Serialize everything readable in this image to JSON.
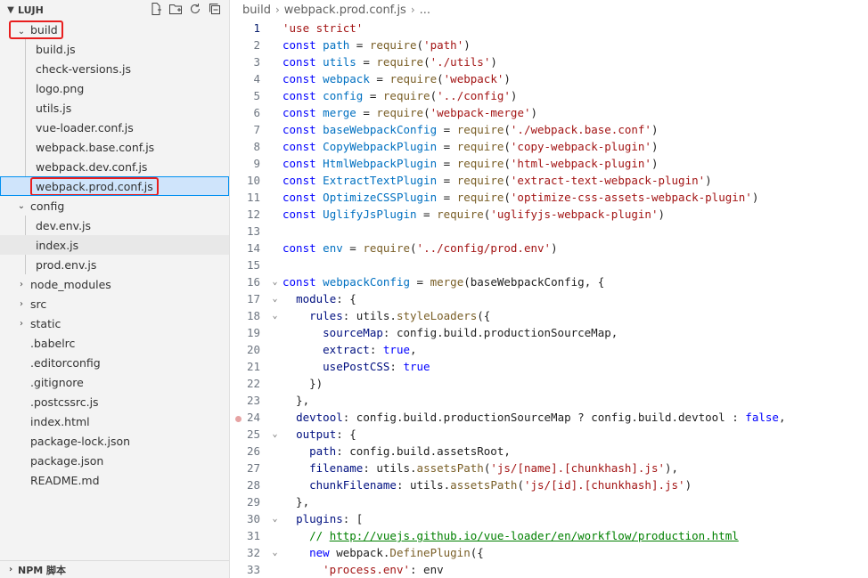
{
  "sidebar": {
    "title": "LUJH",
    "actions": [
      "new-file-icon",
      "new-folder-icon",
      "refresh-icon",
      "collapse-all-icon"
    ],
    "build_folder": "build",
    "build_files": [
      "build.js",
      "check-versions.js",
      "logo.png",
      "utils.js",
      "vue-loader.conf.js",
      "webpack.base.conf.js",
      "webpack.dev.conf.js",
      "webpack.prod.conf.js"
    ],
    "config_folder": "config",
    "config_files": [
      "dev.env.js",
      "index.js",
      "prod.env.js"
    ],
    "folders": [
      "node_modules",
      "src",
      "static"
    ],
    "root_files": [
      ".babelrc",
      ".editorconfig",
      ".gitignore",
      ".postcssrc.js",
      "index.html",
      "package-lock.json",
      "package.json",
      "README.md"
    ],
    "footer": "NPM 脚本"
  },
  "breadcrumb": {
    "folder": "build",
    "file": "webpack.prod.conf.js",
    "more": "..."
  },
  "code_lines": [
    {
      "n": "1",
      "t": "'use strict'"
    },
    {
      "n": "2",
      "t": "const path = require('path')"
    },
    {
      "n": "3",
      "t": "const utils = require('./utils')"
    },
    {
      "n": "4",
      "t": "const webpack = require('webpack')"
    },
    {
      "n": "5",
      "t": "const config = require('../config')"
    },
    {
      "n": "6",
      "t": "const merge = require('webpack-merge')"
    },
    {
      "n": "7",
      "t": "const baseWebpackConfig = require('./webpack.base.conf')"
    },
    {
      "n": "8",
      "t": "const CopyWebpackPlugin = require('copy-webpack-plugin')"
    },
    {
      "n": "9",
      "t": "const HtmlWebpackPlugin = require('html-webpack-plugin')"
    },
    {
      "n": "10",
      "t": "const ExtractTextPlugin = require('extract-text-webpack-plugin')"
    },
    {
      "n": "11",
      "t": "const OptimizeCSSPlugin = require('optimize-css-assets-webpack-plugin')"
    },
    {
      "n": "12",
      "t": "const UglifyJsPlugin = require('uglifyjs-webpack-plugin')"
    },
    {
      "n": "13",
      "t": ""
    },
    {
      "n": "14",
      "t": "const env = require('../config/prod.env')"
    },
    {
      "n": "15",
      "t": ""
    },
    {
      "n": "16",
      "t": "const webpackConfig = merge(baseWebpackConfig, {"
    },
    {
      "n": "17",
      "t": "  module: {"
    },
    {
      "n": "18",
      "t": "    rules: utils.styleLoaders({"
    },
    {
      "n": "19",
      "t": "      sourceMap: config.build.productionSourceMap,"
    },
    {
      "n": "20",
      "t": "      extract: true,"
    },
    {
      "n": "21",
      "t": "      usePostCSS: true"
    },
    {
      "n": "22",
      "t": "    })"
    },
    {
      "n": "23",
      "t": "  },"
    },
    {
      "n": "24",
      "t": "  devtool: config.build.productionSourceMap ? config.build.devtool : false,"
    },
    {
      "n": "25",
      "t": "  output: {"
    },
    {
      "n": "26",
      "t": "    path: config.build.assetsRoot,"
    },
    {
      "n": "27",
      "t": "    filename: utils.assetsPath('js/[name].[chunkhash].js'),"
    },
    {
      "n": "28",
      "t": "    chunkFilename: utils.assetsPath('js/[id].[chunkhash].js')"
    },
    {
      "n": "29",
      "t": "  },"
    },
    {
      "n": "30",
      "t": "  plugins: ["
    },
    {
      "n": "31",
      "t": "    // http://vuejs.github.io/vue-loader/en/workflow/production.html"
    },
    {
      "n": "32",
      "t": "    new webpack.DefinePlugin({"
    },
    {
      "n": "33",
      "t": "      'process.env': env"
    }
  ],
  "fold_lines": [
    "16",
    "17",
    "18",
    "25",
    "30",
    "32"
  ],
  "active_line": "1",
  "breakpoint_line": "24"
}
